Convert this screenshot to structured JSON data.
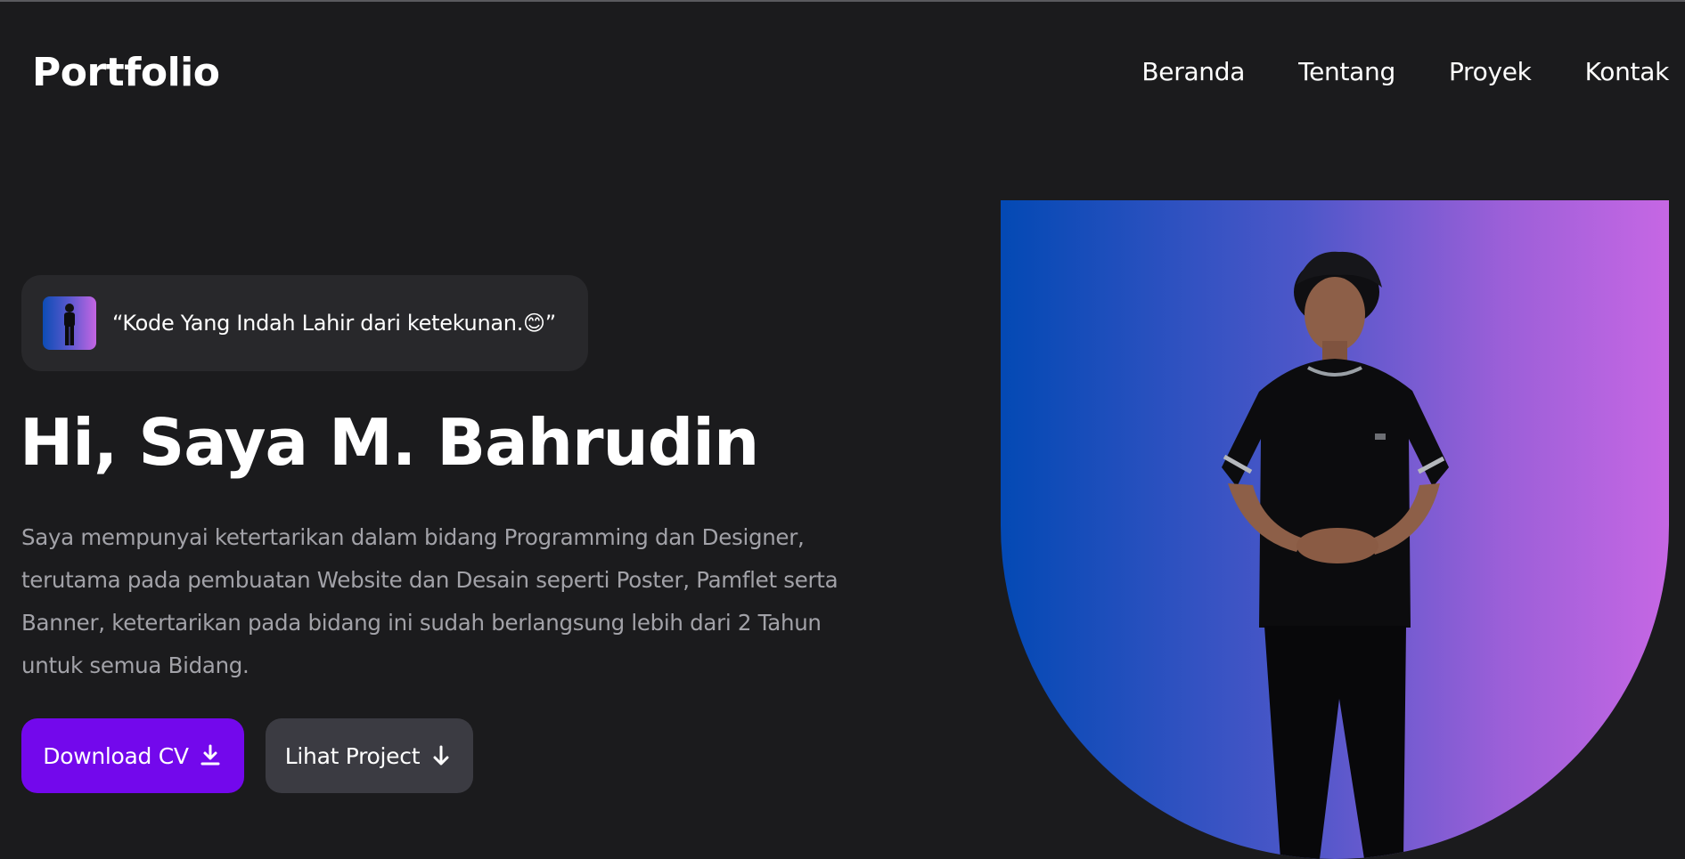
{
  "header": {
    "logo": "Portfolio",
    "nav": [
      {
        "label": "Beranda"
      },
      {
        "label": "Tentang"
      },
      {
        "label": "Proyek"
      },
      {
        "label": "Kontak"
      }
    ]
  },
  "hero": {
    "quote": "“Kode Yang Indah Lahir dari ketekunan.😊”",
    "title": "Hi, Saya M. Bahrudin",
    "description": "Saya mempunyai ketertarikan dalam bidang Programming dan Designer, terutama pada pembuatan Website dan Desain seperti Poster, Pamflet serta Banner, ketertarikan pada bidang ini sudah berlangsung lebih dari 2 Tahun untuk semua Bidang.",
    "buttons": {
      "download_cv": "Download CV",
      "lihat_project": "Lihat Project"
    }
  },
  "icons": {
    "download": "download-icon",
    "arrow_down": "arrow-down-icon"
  },
  "colors": {
    "background": "#1b1b1d",
    "card": "#28282b",
    "primary_button": "#7308ec",
    "secondary_button": "#3b3b42",
    "gradient_start": "#0349b4",
    "gradient_end": "#c667e4",
    "muted_text": "#a2a2a8"
  }
}
